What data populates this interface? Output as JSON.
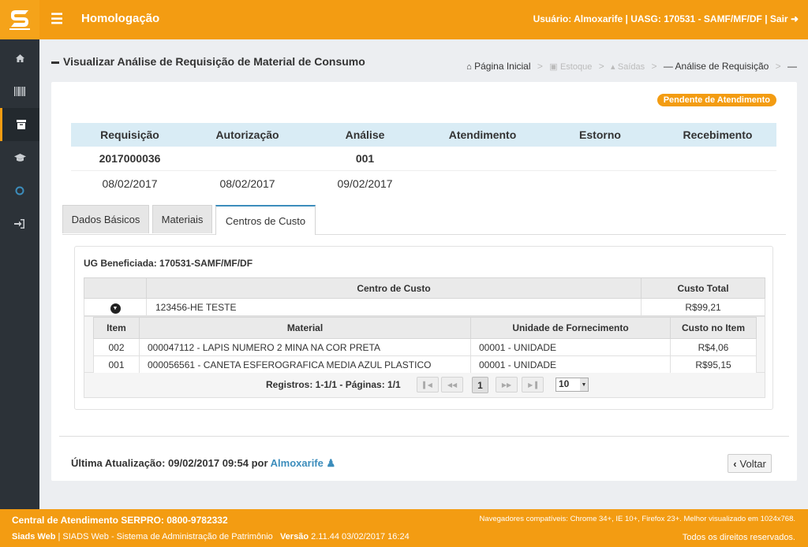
{
  "header": {
    "env_title": "Homologação",
    "user_info": "Usuário: Almoxarife | UASG: 170531 - SAMF/MF/DF | Sair",
    "menu_icon": "bars-icon",
    "logout_icon": "sign-out-icon"
  },
  "sidebar": {
    "items": [
      {
        "icon": "home-icon"
      },
      {
        "icon": "barcode-icon"
      },
      {
        "icon": "archive-icon"
      },
      {
        "icon": "graduation-cap-icon"
      },
      {
        "icon": "circle-icon"
      },
      {
        "icon": "sign-in-icon"
      }
    ]
  },
  "page": {
    "title": "Visualizar Análise de Requisição de Material de Consumo",
    "breadcrumb": [
      "Página Inicial",
      "Estoque",
      "Saídas",
      "Análise de Requisição"
    ]
  },
  "status_badge": "Pendente de Atendimento",
  "steps": {
    "headers": [
      "Requisição",
      "Autorização",
      "Análise",
      "Atendimento",
      "Estorno",
      "Recebimento"
    ],
    "numbers": [
      "2017000036",
      "",
      "001",
      "",
      "",
      ""
    ],
    "dates": [
      "08/02/2017",
      "08/02/2017",
      "09/02/2017",
      "",
      "",
      ""
    ]
  },
  "tabs": [
    "Dados Básicos",
    "Materiais",
    "Centros de Custo"
  ],
  "active_tab": "Centros de Custo",
  "centros": {
    "ug_label": "UG Beneficiada: 170531-SAMF/MF/DF",
    "columns": [
      "Centro de Custo",
      "Custo Total"
    ],
    "row": {
      "centro": "123456-HE TESTE",
      "total": "R$99,21"
    },
    "sub_columns": [
      "Item",
      "Material",
      "Unidade de Fornecimento",
      "Custo no Item"
    ],
    "items": [
      {
        "item": "002",
        "material": "000047112 - LAPIS NUMERO 2 MINA NA COR PRETA",
        "unidade": "00001 - UNIDADE",
        "custo": "R$4,06"
      },
      {
        "item": "001",
        "material": "000056561 - CANETA ESFEROGRAFICA MEDIA AZUL PLASTICO",
        "unidade": "00001 - UNIDADE",
        "custo": "R$95,15"
      }
    ],
    "pager_text": "Registros: 1-1/1 - Páginas: 1/1",
    "current_page": "1",
    "page_size": "10"
  },
  "footer_info": {
    "last_update_label": "Última Atualização: 09/02/2017 09:54 por",
    "last_update_user": "Almoxarife",
    "back_label": "Voltar"
  },
  "footer": {
    "support": "Central de Atendimento SERPRO: 0800-9782332",
    "browsers": "Navegadores compatíveis: Chrome 34+, IE 10+, Firefox 23+. Melhor visualizado em 1024x768.",
    "system_name": "Siads Web",
    "system_desc": "| SIADS Web - Sistema de Administração de Patrimônio",
    "version_label": "Versão",
    "version": "2.11.44 03/02/2017 16:24",
    "rights": "Todos os direitos reservados."
  },
  "colors": {
    "accent": "#f39c12",
    "sidebar": "#2c3238",
    "link": "#3c8dbc",
    "step_header": "#d9ecf5"
  }
}
